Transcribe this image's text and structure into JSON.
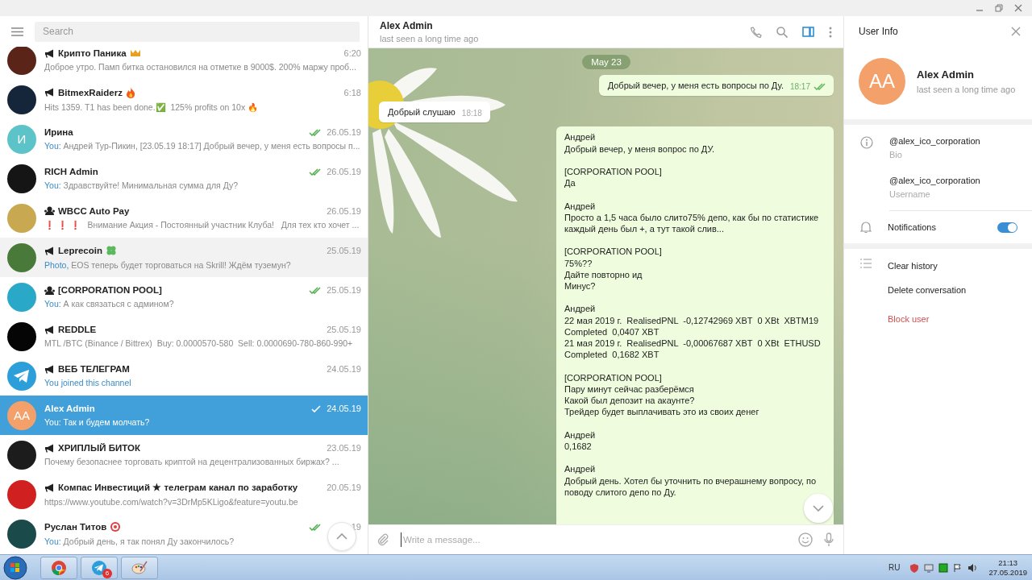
{
  "sidebar": {
    "search": {
      "placeholder": "Search"
    },
    "chats": [
      {
        "name": "Крипто Паника",
        "kind": "channel",
        "emoji": {
          "kind": "crown"
        },
        "time": "6:20",
        "sent": false,
        "preview": "Доброе утро. Памп битка остановился на отметке в 9000$. 200% маржу проб...",
        "avatar": {
          "kind": "photo",
          "color": "#5a2418"
        },
        "selected": false,
        "hovered": false
      },
      {
        "name": "BitmexRaiderz",
        "kind": "channel",
        "emoji": {
          "kind": "fire"
        },
        "time": "6:18",
        "sent": false,
        "preview": "Hits 1359. T1 has been done.✅  125% profits on 10x 🔥",
        "avatar": {
          "kind": "photo",
          "color": "#16263a"
        },
        "selected": false,
        "hovered": false
      },
      {
        "name": "Ирина",
        "kind": "user",
        "time": "26.05.19",
        "sent": true,
        "read": true,
        "preview_prefix": "You:",
        "preview": "Андрей Тур-Пикин, [23.05.19 18:17] Добрый вечер, у меня есть вопросы п...",
        "avatar": {
          "kind": "initials",
          "initials": "И",
          "color": "#5cc4c8"
        },
        "selected": false,
        "hovered": false
      },
      {
        "name": "RICH Admin",
        "kind": "user",
        "time": "26.05.19",
        "sent": true,
        "read": true,
        "preview_prefix": "You:",
        "preview": "Здравствуйте! Минимальная сумма для Ду?",
        "avatar": {
          "kind": "photo",
          "color": "#151515"
        },
        "selected": false,
        "hovered": false
      },
      {
        "name": "WBCC Auto Pay",
        "kind": "group",
        "time": "26.05.19",
        "sent": false,
        "preview": "❗ ❗ ❗   Внимание Акция - Постоянный участник Клуба!   Для тех кто хочет ...",
        "avatar": {
          "kind": "photo",
          "color": "#c8a850"
        },
        "selected": false,
        "hovered": false
      },
      {
        "name": "Leprecoin",
        "kind": "channel",
        "emoji": {
          "kind": "clover"
        },
        "time": "25.05.19",
        "sent": false,
        "preview_prefix": "Photo,",
        "preview": "EOS теперь будет торговаться на Skrill! Ждём туземун?",
        "avatar": {
          "kind": "photo",
          "color": "#4a7a3a"
        },
        "selected": false,
        "hovered": true
      },
      {
        "name": "[CORPORATION POOL]",
        "kind": "group",
        "time": "25.05.19",
        "sent": true,
        "read": true,
        "preview_prefix": "You:",
        "preview": "А как связаться с админом?",
        "avatar": {
          "kind": "photo",
          "color": "#2aa8c8"
        },
        "selected": false,
        "hovered": false
      },
      {
        "name": "REDDLE",
        "kind": "channel",
        "time": "25.05.19",
        "sent": false,
        "preview": "MTL /BTC (Binance / Bittrex)  Buy: 0.0000570-580  Sell: 0.0000690-780-860-990+",
        "avatar": {
          "kind": "photo",
          "color": "#050505"
        },
        "selected": false,
        "hovered": false
      },
      {
        "name": "ВЕБ ТЕЛЕГРАМ",
        "kind": "channel",
        "time": "24.05.19",
        "sent": false,
        "preview_prefix": "You joined this channel",
        "avatar": {
          "kind": "logo",
          "color": "#2c9fdb"
        },
        "selected": false,
        "hovered": false
      },
      {
        "name": "Alex Admin",
        "kind": "user",
        "time": "24.05.19",
        "sent": true,
        "read": false,
        "preview_prefix": "You:",
        "preview": "Так и будем молчать?",
        "avatar": {
          "kind": "initials",
          "initials": "AA",
          "color": "#f4a06a"
        },
        "selected": true,
        "hovered": false
      },
      {
        "name": "ХРИПЛЫЙ БИТОК",
        "kind": "channel",
        "time": "23.05.19",
        "sent": false,
        "preview": "Почему безопаснее торговать криптой на децентрализованных биржах? ...",
        "avatar": {
          "kind": "photo",
          "color": "#1c1c1c"
        },
        "selected": false,
        "hovered": false
      },
      {
        "name": "Компас Инвестиций ★ телеграм канал по заработку",
        "kind": "channel",
        "time": "20.05.19",
        "sent": false,
        "preview": "https://www.youtube.com/watch?v=3DrMp5KLigo&feature=youtu.be",
        "avatar": {
          "kind": "photo",
          "color": "#d02020"
        },
        "selected": false,
        "hovered": false
      },
      {
        "name": "Руслан Титов",
        "kind": "user",
        "emoji": {
          "kind": "target"
        },
        "time": "19",
        "sent": true,
        "read": true,
        "preview_prefix": "You:",
        "preview": "Добрый день, я так понял Ду закончилось?",
        "avatar": {
          "kind": "photo",
          "color": "#1a4a4a"
        },
        "selected": false,
        "hovered": false
      }
    ]
  },
  "chat": {
    "header": {
      "name": "Alex Admin",
      "status": "last seen a long time ago"
    },
    "date": "May 23",
    "messages": [
      {
        "outgoing": true,
        "text": "Добрый вечер, у меня есть вопросы по Ду.",
        "time": "18:17",
        "sent": true,
        "read": true
      },
      {
        "outgoing": false,
        "text": "Добрый слушаю",
        "time": "18:18",
        "sent": false
      },
      {
        "outgoing": true,
        "text": "Андрей\nДобрый вечер, у меня вопрос по ДУ.\n\n[CORPORATION POOL]\nДа\n\nАндрей\nПросто а 1,5 часа было слито75% депо, как бы по статистике\nкаждый день был +, а тут такой слив...\n\n[CORPORATION POOL]\n75%??\nДайте повторно ид\nМинус?\n\nАндрей\n22 мая 2019 г.  RealisedPNL  -0,12742969 XBT  0 XBt  XBTM19\nCompleted  0,0407 XBT\n21 мая 2019 г.  RealisedPNL  -0,00067687 XBT  0 XBt  ETHUSD\nCompleted  0,1682 XBT\n\n[CORPORATION POOL]\nПару минут сейчас разберёмся\nКакой был депозит на акаунте?\nТрейдер будет выплачивать это из своих денег\n\nАндрей\n0,1682\n\nАндрей\nДобрый день. Хотел бы уточнить по вчерашнему вопросу, по\nповоду слитого депо по Ду.",
        "sent": false
      }
    ],
    "composer": {
      "placeholder": "Write a message..."
    }
  },
  "info": {
    "title": "User Info",
    "avatar": {
      "initials": "AA",
      "color": "#f4a06a"
    },
    "name": "Alex Admin",
    "status": "last seen a long time ago",
    "fields": [
      {
        "value": "@alex_ico_corporation",
        "label": "Bio"
      },
      {
        "value": "@alex_ico_corporation",
        "label": "Username"
      }
    ],
    "notifications": {
      "label": "Notifications",
      "on": true
    },
    "actions": [
      {
        "label": "Clear history",
        "kind": "normal"
      },
      {
        "label": "Delete conversation",
        "kind": "normal"
      },
      {
        "label": "Block user",
        "kind": "danger"
      }
    ]
  },
  "taskbar": {
    "apps": [
      {
        "kind": "chrome"
      },
      {
        "kind": "telegram",
        "badge": "6"
      },
      {
        "kind": "paint"
      }
    ],
    "language": "RU",
    "time": "21:13",
    "date": "27.05.2019"
  }
}
